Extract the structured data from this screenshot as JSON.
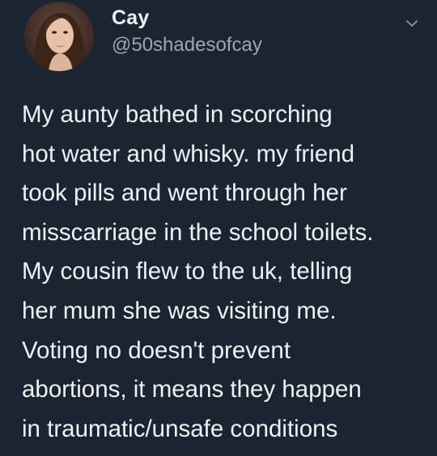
{
  "tweet": {
    "author": {
      "display_name": "Cay",
      "handle": "@50shadesofcay",
      "avatar_icon": "profile-photo"
    },
    "menu_icon": "chevron-down-icon",
    "text_lines": [
      "My aunty bathed in scorching",
      "hot water and whisky. my friend",
      "took pills and went through her",
      "misscarriage in the school toilets.",
      "My cousin flew to the uk, telling",
      "her mum she was visiting me.",
      "Voting no doesn't prevent",
      "abortions, it means they happen",
      "in traumatic/unsafe conditions"
    ]
  },
  "colors": {
    "background": "#1b2532",
    "text": "#eef1f4",
    "secondary_text": "#9aa6b3"
  }
}
